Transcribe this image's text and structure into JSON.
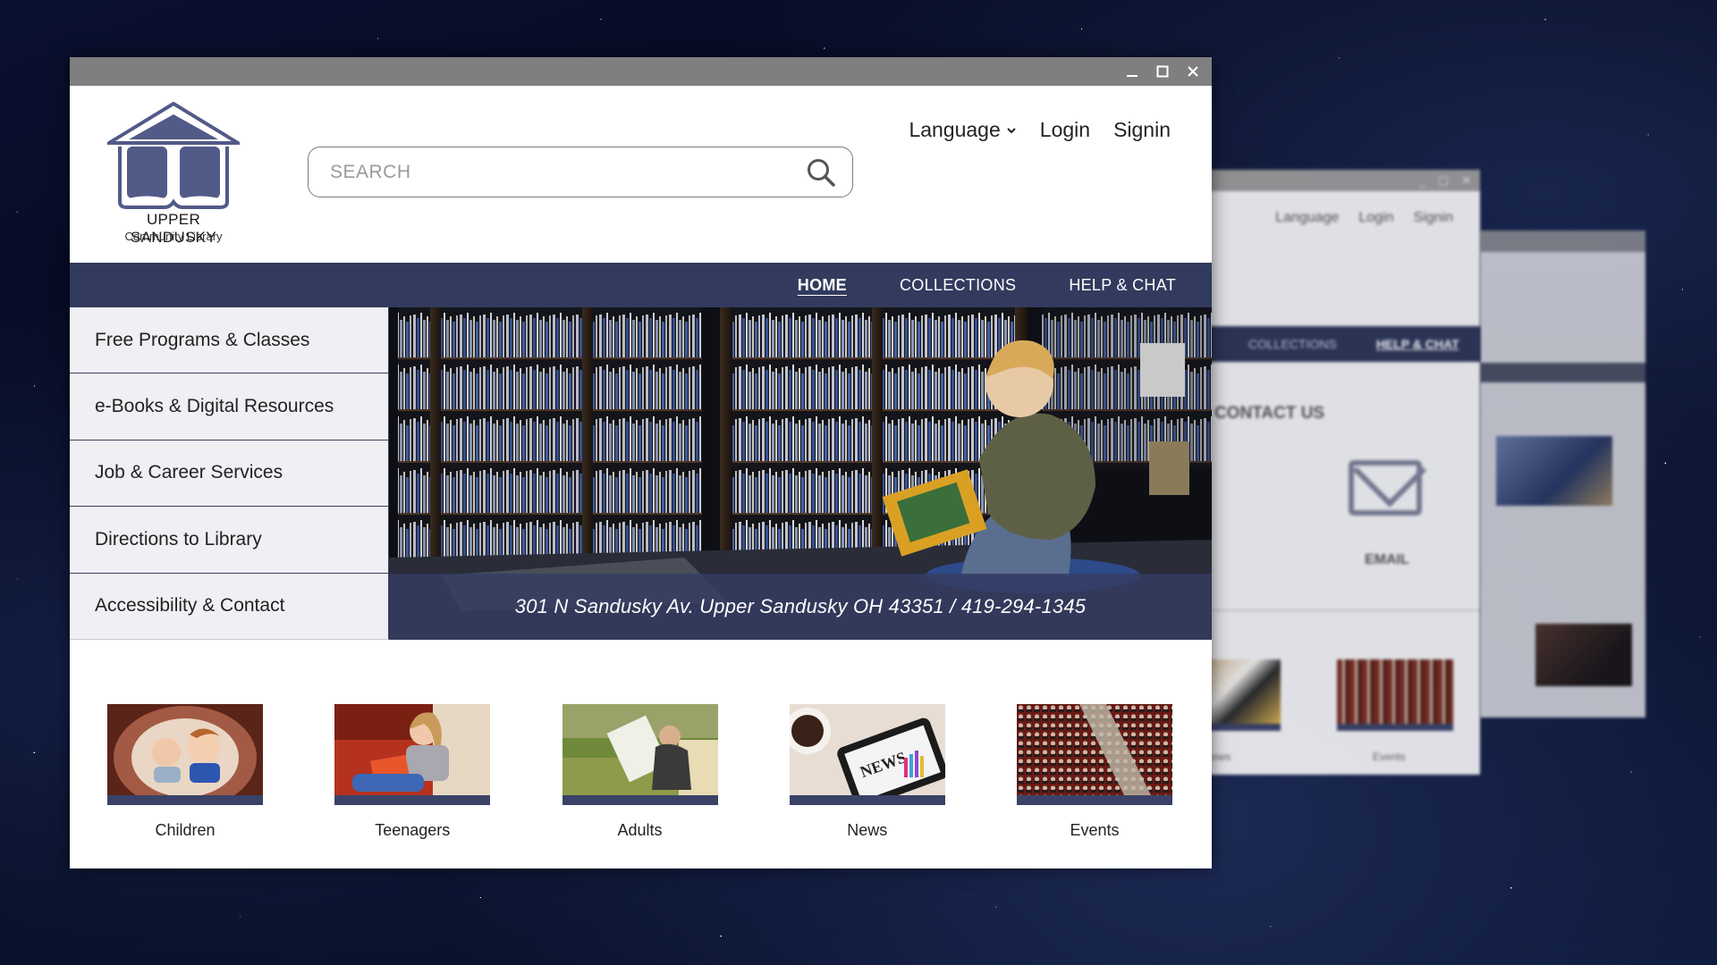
{
  "background_windows": {
    "mid": {
      "top_links": [
        "Language",
        "Login",
        "Signin"
      ],
      "nav": [
        "COLLECTIONS",
        "HELP & CHAT"
      ],
      "heading": "E CONTACT US",
      "email_label": "EMAIL",
      "captions": [
        "ews",
        "Events"
      ]
    }
  },
  "window": {
    "controls": [
      "minimize-icon",
      "maximize-icon",
      "close-icon"
    ]
  },
  "logo": {
    "name": "UPPER SANDUSKY",
    "subtitle": "Community Library",
    "color": "#525a88"
  },
  "search": {
    "placeholder": "SEARCH",
    "value": ""
  },
  "top_links": {
    "language": "Language",
    "login": "Login",
    "signin": "Signin"
  },
  "nav": {
    "items": [
      {
        "label": "HOME",
        "active": true
      },
      {
        "label": "COLLECTIONS",
        "active": false
      },
      {
        "label": "HELP & CHAT",
        "active": false
      }
    ]
  },
  "side_menu": {
    "items": [
      {
        "label": "Free Programs & Classes"
      },
      {
        "label": "e-Books & Digital Resources"
      },
      {
        "label": "Job & Career Services"
      },
      {
        "label": "Directions to Library"
      },
      {
        "label": "Accessibility & Contact"
      }
    ]
  },
  "hero": {
    "caption": "301 N Sandusky Av. Upper Sandusky OH 43351 / 419-294-1345",
    "image": "child-reading-in-library-photo"
  },
  "tiles": [
    {
      "label": "Children",
      "image": "children-photo"
    },
    {
      "label": "Teenagers",
      "image": "teen-reading-photo"
    },
    {
      "label": "Adults",
      "image": "adult-reading-newspaper-photo"
    },
    {
      "label": "News",
      "image": "tablet-news-photo"
    },
    {
      "label": "Events",
      "image": "auditorium-event-photo"
    }
  ],
  "colors": {
    "navbar": "#323b5e",
    "tile_bar": "#3a4268",
    "titlebar": "#7f7f7f",
    "side_menu_bg": "#f0f0f4"
  }
}
